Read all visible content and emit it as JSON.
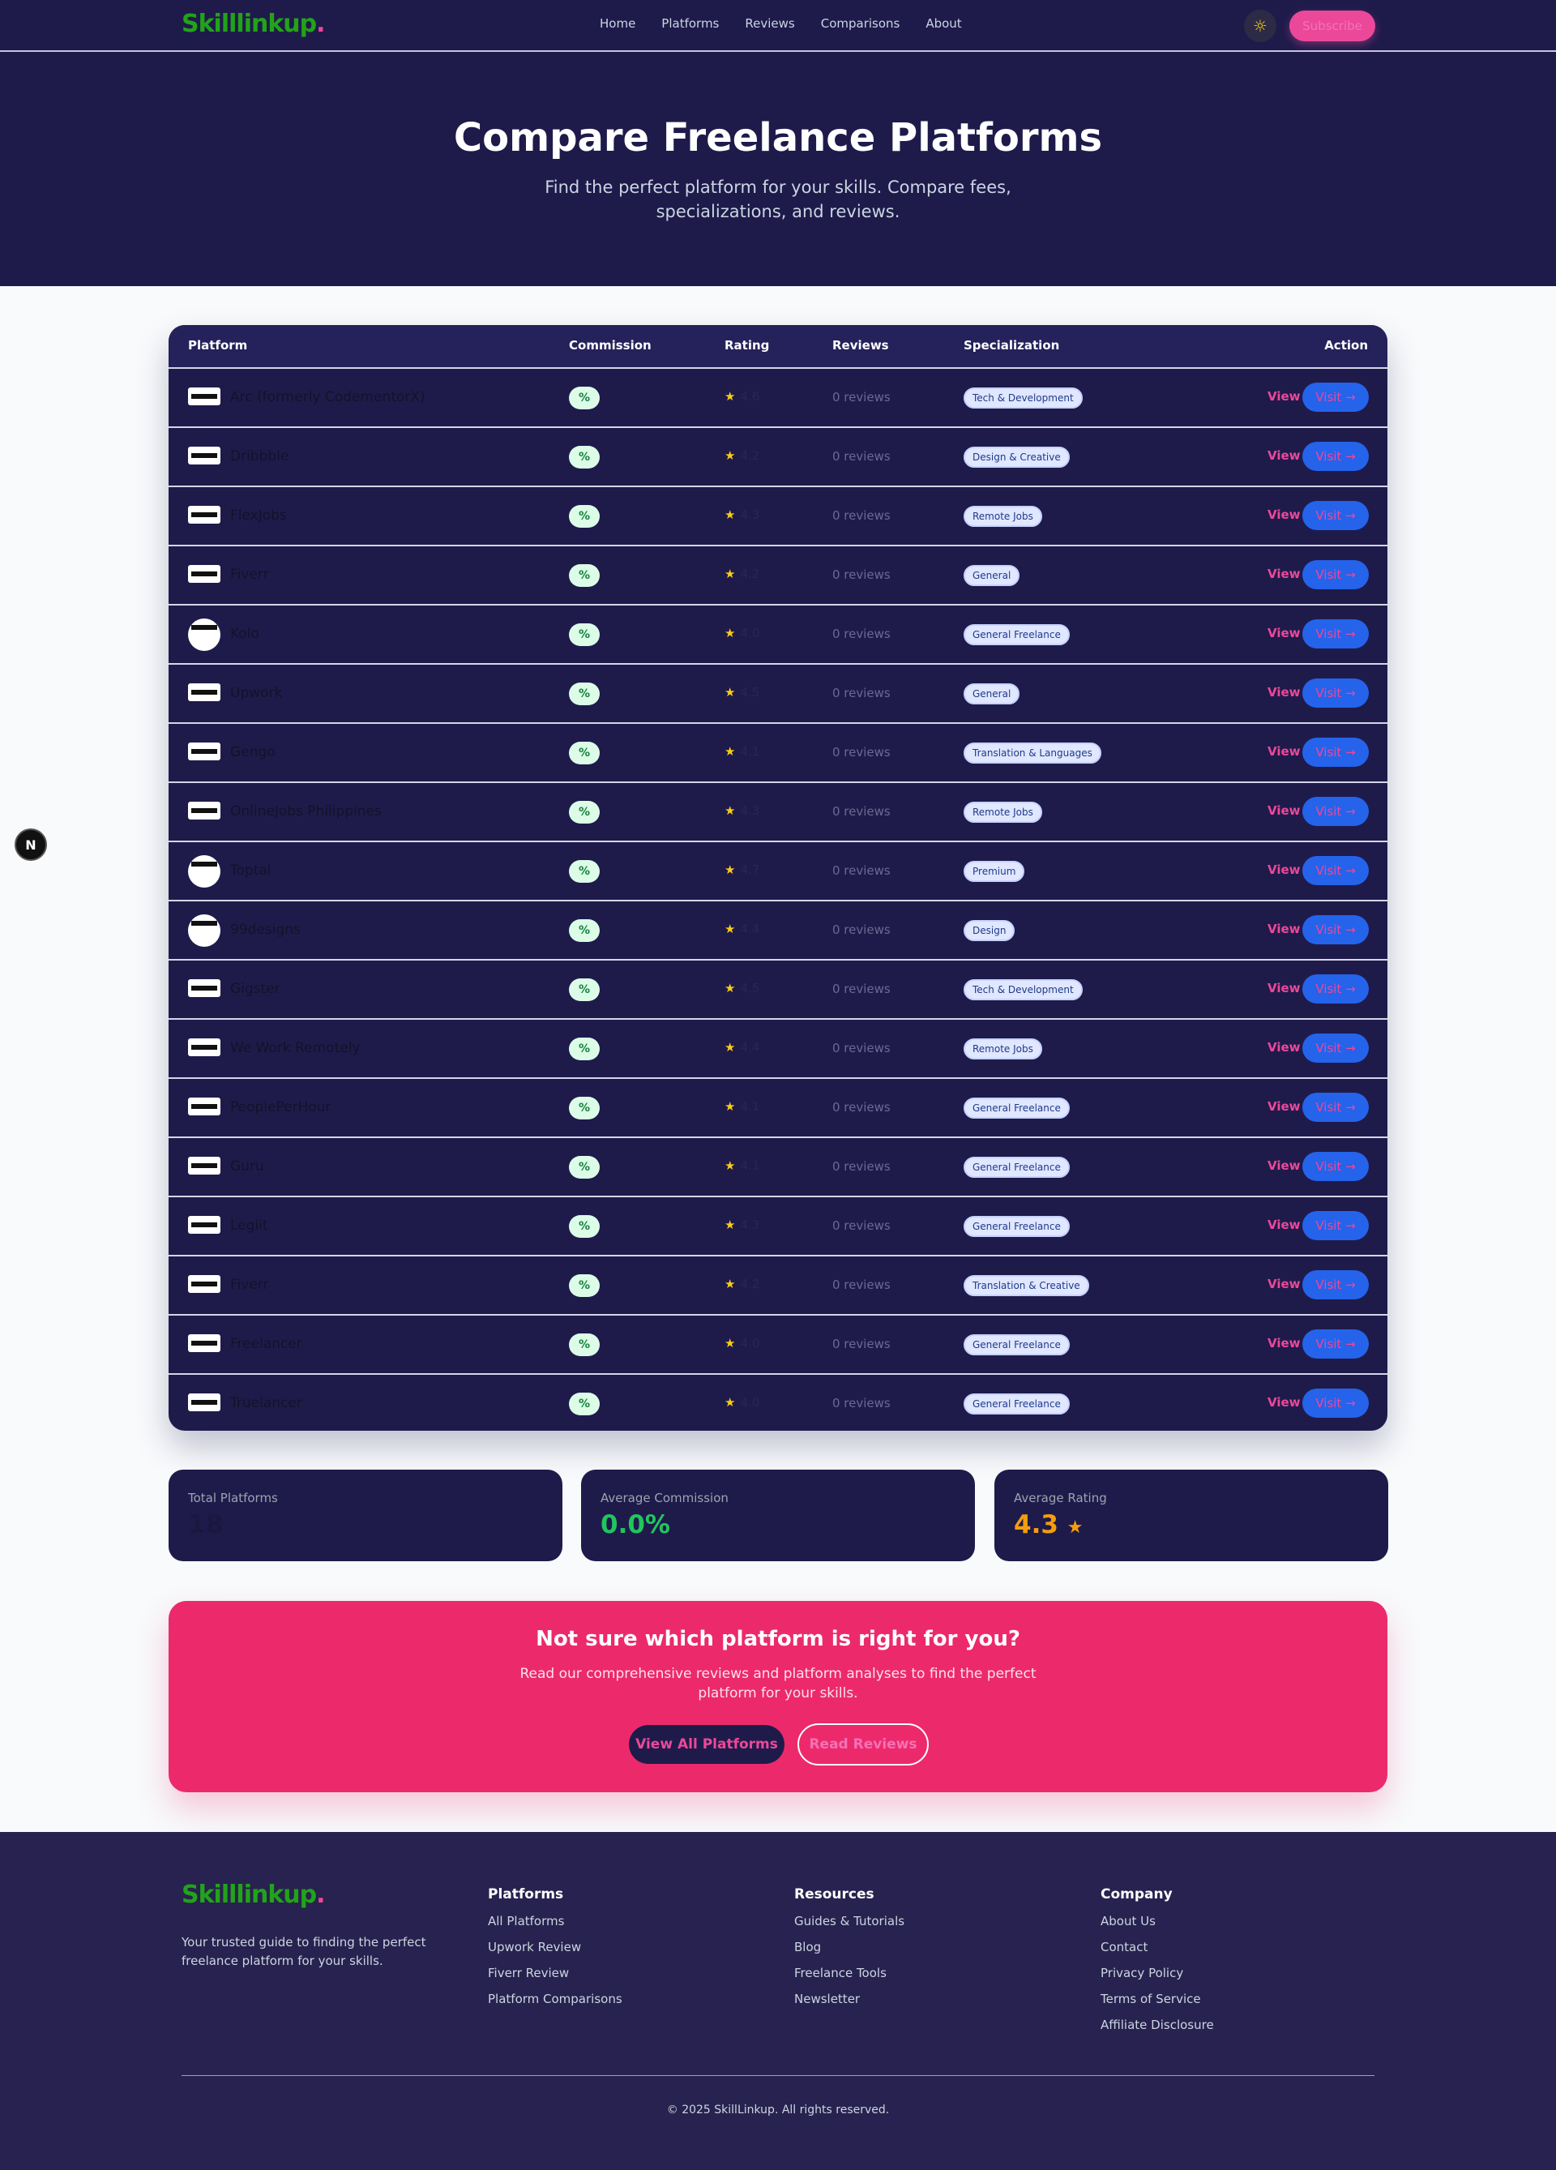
{
  "nav": {
    "logo": "Skilllinkup",
    "logo_dot": ".",
    "links": [
      "Home",
      "Platforms",
      "Reviews",
      "Comparisons",
      "About"
    ],
    "theme_icon": "sun-icon",
    "subscribe_label": "Subscribe"
  },
  "hero": {
    "title": "Compare Freelance Platforms",
    "subtitle": "Find the perfect platform for your skills. Compare fees, specializations, and reviews."
  },
  "table": {
    "headers": {
      "platform": "Platform",
      "commission": "Commission",
      "rating": "Rating",
      "reviews": "Reviews",
      "specialization": "Specialization",
      "action": "Action"
    },
    "rows": [
      {
        "name": "Arc (formerly CodementorX)",
        "commission": "%",
        "rating": "4.6",
        "reviews": "0 reviews",
        "spec": "Tech & Development",
        "view": "View",
        "visit": "Visit →"
      },
      {
        "name": "Dribbble",
        "commission": "%",
        "rating": "4.2",
        "reviews": "0 reviews",
        "spec": "Design & Creative",
        "view": "View",
        "visit": "Visit →"
      },
      {
        "name": "FlexJobs",
        "commission": "%",
        "rating": "4.3",
        "reviews": "0 reviews",
        "spec": "Remote Jobs",
        "view": "View",
        "visit": "Visit →"
      },
      {
        "name": "Fiverr",
        "commission": "%",
        "rating": "4.2",
        "reviews": "0 reviews",
        "spec": "General",
        "view": "View",
        "visit": "Visit →"
      },
      {
        "name": "Kolo",
        "commission": "%",
        "rating": "4.0",
        "reviews": "0 reviews",
        "spec": "General Freelance",
        "view": "View",
        "visit": "Visit →"
      },
      {
        "name": "Upwork",
        "commission": "%",
        "rating": "4.5",
        "reviews": "0 reviews",
        "spec": "General",
        "view": "View",
        "visit": "Visit →"
      },
      {
        "name": "Gengo",
        "commission": "%",
        "rating": "4.1",
        "reviews": "0 reviews",
        "spec": "Translation & Languages",
        "view": "View",
        "visit": "Visit →"
      },
      {
        "name": "OnlineJobs Philippines",
        "commission": "%",
        "rating": "4.3",
        "reviews": "0 reviews",
        "spec": "Remote Jobs",
        "view": "View",
        "visit": "Visit →"
      },
      {
        "name": "Toptal",
        "commission": "%",
        "rating": "4.7",
        "reviews": "0 reviews",
        "spec": "Premium",
        "view": "View",
        "visit": "Visit →"
      },
      {
        "name": "99designs",
        "commission": "%",
        "rating": "4.4",
        "reviews": "0 reviews",
        "spec": "Design",
        "view": "View",
        "visit": "Visit →"
      },
      {
        "name": "Gigster",
        "commission": "%",
        "rating": "4.5",
        "reviews": "0 reviews",
        "spec": "Tech & Development",
        "view": "View",
        "visit": "Visit →"
      },
      {
        "name": "We Work Remotely",
        "commission": "%",
        "rating": "4.4",
        "reviews": "0 reviews",
        "spec": "Remote Jobs",
        "view": "View",
        "visit": "Visit →"
      },
      {
        "name": "PeoplePerHour",
        "commission": "%",
        "rating": "4.1",
        "reviews": "0 reviews",
        "spec": "General Freelance",
        "view": "View",
        "visit": "Visit →"
      },
      {
        "name": "Guru",
        "commission": "%",
        "rating": "4.1",
        "reviews": "0 reviews",
        "spec": "General Freelance",
        "view": "View",
        "visit": "Visit →"
      },
      {
        "name": "Legiit",
        "commission": "%",
        "rating": "4.3",
        "reviews": "0 reviews",
        "spec": "General Freelance",
        "view": "View",
        "visit": "Visit →"
      },
      {
        "name": "Fiverr",
        "commission": "%",
        "rating": "4.2",
        "reviews": "0 reviews",
        "spec": "Translation & Creative",
        "view": "View",
        "visit": "Visit →"
      },
      {
        "name": "Freelancer",
        "commission": "%",
        "rating": "4.0",
        "reviews": "0 reviews",
        "spec": "General Freelance",
        "view": "View",
        "visit": "Visit →"
      },
      {
        "name": "Truelancer",
        "commission": "%",
        "rating": "4.0",
        "reviews": "0 reviews",
        "spec": "General Freelance",
        "view": "View",
        "visit": "Visit →"
      }
    ]
  },
  "floating": {
    "label": "N"
  },
  "stats": [
    {
      "label": "Total Platforms",
      "value": "18",
      "color": "#1a1740"
    },
    {
      "label": "Average Commission",
      "value": "0.0%",
      "color": "#22c55e"
    },
    {
      "label": "Average Rating",
      "value": "4.3",
      "suffix": "★",
      "color": "#f59e0b"
    }
  ],
  "cta": {
    "title": "Not sure which platform is right for you?",
    "text": "Read our comprehensive reviews and platform analyses to find the perfect platform for your skills.",
    "primary": "View All Platforms",
    "secondary": "Read Reviews"
  },
  "footer": {
    "logo": "Skilllinkup",
    "logo_dot": ".",
    "tagline": "Your trusted guide to finding the perfect freelance platform for your skills.",
    "columns": [
      {
        "title": "Platforms",
        "links": [
          "All Platforms",
          "Upwork Review",
          "Fiverr Review",
          "Platform Comparisons"
        ]
      },
      {
        "title": "Resources",
        "links": [
          "Guides & Tutorials",
          "Blog",
          "Freelance Tools",
          "Newsletter"
        ]
      },
      {
        "title": "Company",
        "links": [
          "About Us",
          "Contact",
          "Privacy Policy",
          "Terms of Service",
          "Affiliate Disclosure"
        ]
      }
    ],
    "copyright": "© 2025 SkillLinkup. All rights reserved."
  },
  "colors": {
    "navy": "#1e1b4b",
    "pink": "#ec4899",
    "blue": "#2563eb",
    "green": "#22a319"
  }
}
